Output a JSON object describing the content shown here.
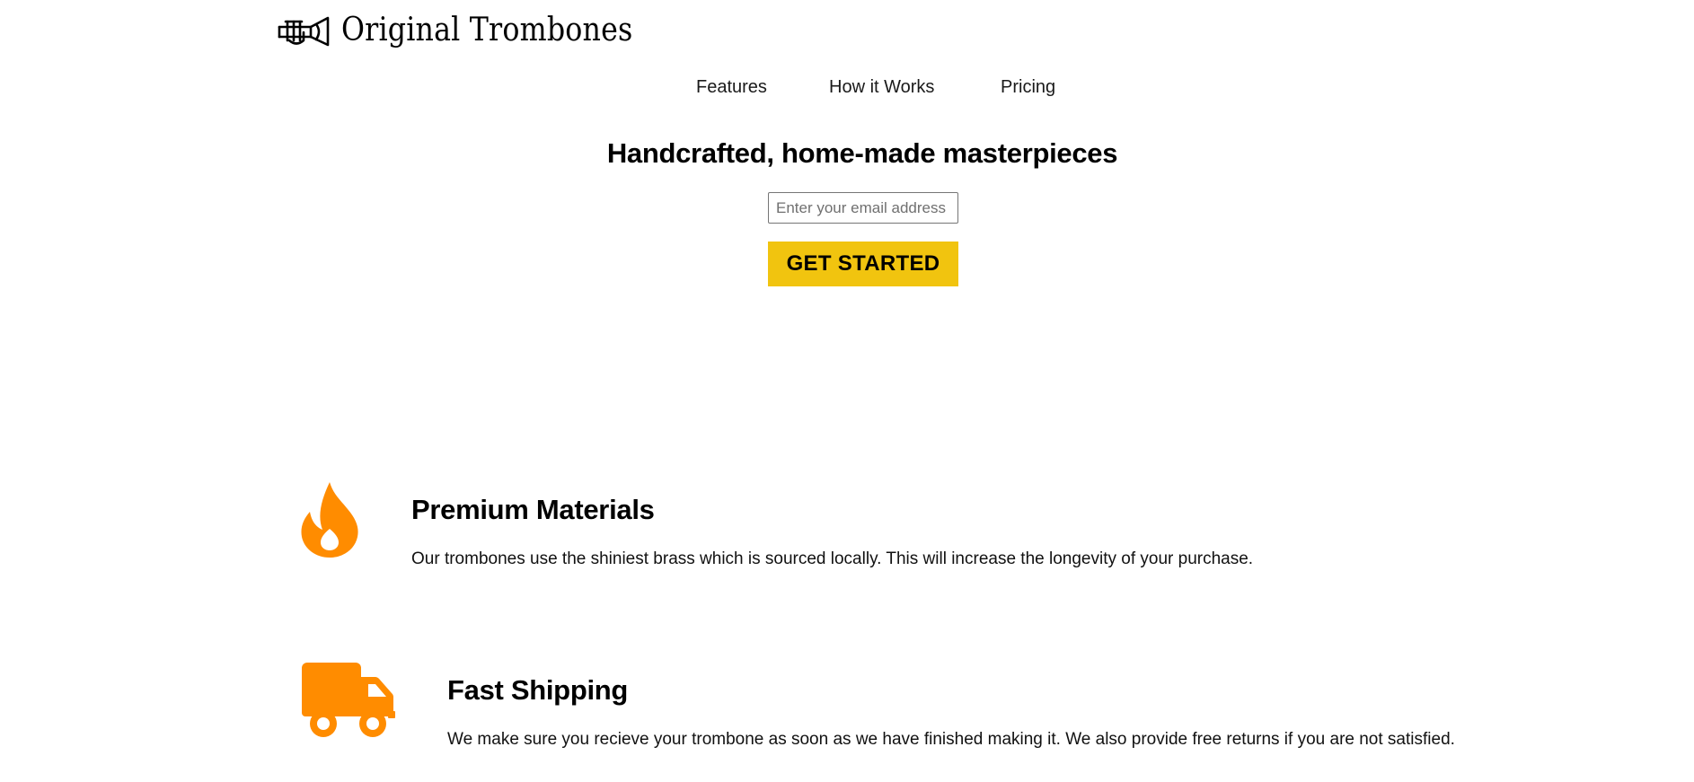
{
  "brand": {
    "name": "Original Trombones",
    "logo_icon": "trombone-icon"
  },
  "nav": {
    "items": [
      {
        "label": "Features"
      },
      {
        "label": "How it Works"
      },
      {
        "label": "Pricing"
      }
    ]
  },
  "hero": {
    "title": "Handcrafted, home-made masterpieces",
    "email_placeholder": "Enter your email address",
    "email_value": "",
    "cta_label": "GET STARTED"
  },
  "features": [
    {
      "icon": "fire-icon",
      "title": "Premium Materials",
      "description": "Our trombones use the shiniest brass which is sourced locally. This will increase the longevity of your purchase."
    },
    {
      "icon": "truck-icon",
      "title": "Fast Shipping",
      "description": "We make sure you recieve your trombone as soon as we have finished making it. We also provide free returns if you are not satisfied."
    }
  ],
  "colors": {
    "accent": "#f1c40f",
    "icon": "#ff8c00",
    "text": "#000000",
    "background": "#ffffff"
  }
}
